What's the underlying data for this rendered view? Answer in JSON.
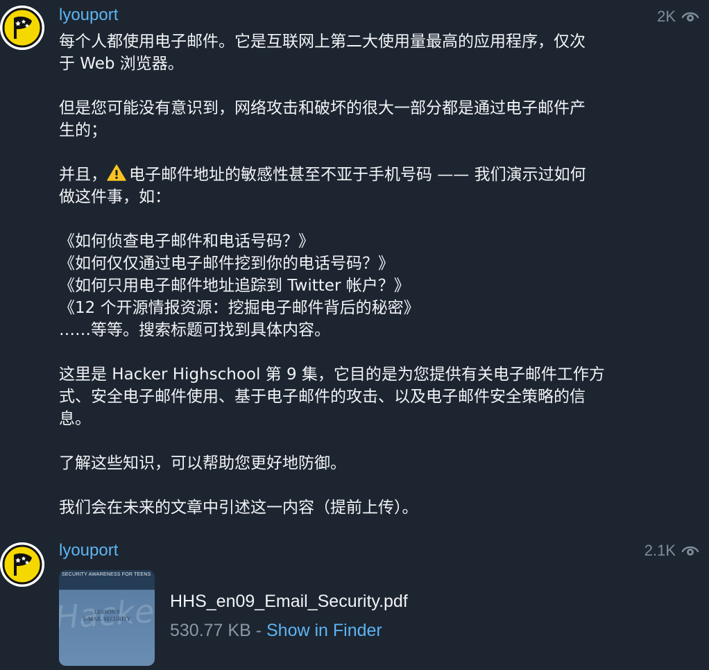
{
  "messages": [
    {
      "sender": "lyouport",
      "views": "2K",
      "paragraphs": {
        "p1": "每个人都使用电子邮件。它是互联网上第二大使用量最高的应用程序，仅次\n于 Web 浏览器。",
        "p2": "但是您可能没有意识到，网络攻击和破坏的很大一部分都是通过电子邮件产\n生的；",
        "p3_before": "并且，",
        "p3_after": "电子邮件地址的敏感性甚至不亚于手机号码 —— 我们演示过如何\n做这件事，如：",
        "list": [
          "《如何侦查电子邮件和电话号码？》",
          "《如何仅仅通过电子邮件挖到你的电话号码？》",
          "《如何只用电子邮件地址追踪到 Twitter 帐户？》",
          "《12 个开源情报资源：挖掘电子邮件背后的秘密》",
          "……等等。搜索标题可找到具体内容。"
        ],
        "p4": "这里是 Hacker Highschool 第 9 集，它目的是为您提供有关电子邮件工作方\n式、安全电子邮件使用、基于电子邮件的攻击、以及电子邮件安全策略的信\n息。",
        "p5": "了解这些知识，可以帮助您更好地防御。",
        "p6": "我们会在未来的文章中引述这一内容（提前上传）。"
      }
    },
    {
      "sender": "lyouport",
      "views": "2.1K",
      "file": {
        "thumb_header": "SECURITY AWARENESS FOR TEENS",
        "thumb_lesson": "LESSON 9",
        "thumb_title": "E-MAIL SECURITY",
        "thumb_watermark": "Hacker Highsc",
        "name": "HHS_en09_Email_Security.pdf",
        "size": "530.77 KB",
        "separator": " - ",
        "action": "Show in Finder"
      }
    }
  ],
  "icons": {
    "views": "eye-icon",
    "warning": "warning-icon",
    "avatar": "pirate-flag-logo"
  },
  "colors": {
    "background": "#1c2530",
    "sender": "#5fb4f3",
    "link": "#5fb4f3",
    "meta": "#8a97a5",
    "text": "#f2f4f6",
    "avatar_yellow": "#f5d800"
  }
}
